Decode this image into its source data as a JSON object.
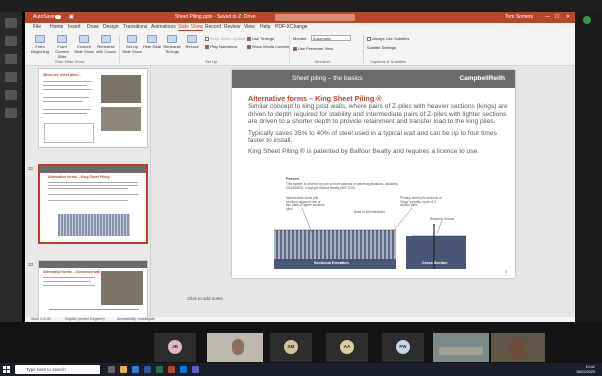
{
  "window": {
    "autosave_label": "AutoSave",
    "title": "Sheet Piling.pptx - Saved to Z: Drive",
    "user": "Tom Somers"
  },
  "ribbon_tabs": [
    "File",
    "Home",
    "Insert",
    "Draw",
    "Design",
    "Transitions",
    "Animations",
    "Slide Show",
    "Record",
    "Review",
    "View",
    "Help",
    "PDF-XChange"
  ],
  "active_tab": "Slide Show",
  "ribbon_tools": {
    "buttons": [
      {
        "label": "From Beginning"
      },
      {
        "label": "From Current Slide"
      },
      {
        "label": "Custom Slide Show"
      },
      {
        "label": "Rehearse with Coach"
      },
      {
        "label": "Set Up Slide Show"
      },
      {
        "label": "Hide Slide"
      },
      {
        "label": "Rehearse Timings"
      },
      {
        "label": "Record"
      }
    ],
    "checks": [
      {
        "label": "Keep Slides Updated"
      },
      {
        "label": "Play Narrations"
      },
      {
        "label": "Use Timings"
      },
      {
        "label": "Show Media Controls"
      },
      {
        "label": "Use Presenter View"
      },
      {
        "label": "Always Use Subtitles"
      },
      {
        "label": "Subtitle Settings"
      }
    ],
    "monitor_label": "Monitor:",
    "monitor_value": "Automatic",
    "groups": [
      "Start Slide Show",
      "Set Up",
      "Monitors",
      "Captions & Subtitles"
    ]
  },
  "thumbnails": [
    {
      "num": "",
      "title": "When are sheet piles..."
    },
    {
      "num": "22",
      "title": "Alternative forms – King Sheet Piling"
    },
    {
      "num": "23",
      "title": "Alternative forms – Combined wall"
    }
  ],
  "slide": {
    "header": "Sheet piling – the basics",
    "logo": "CampbellReith",
    "heading": "Alternative forms – King Sheet Piling ®",
    "para1": "Similar concept to king post walls, where pairs of Z-piles with heavier sections (kings) are driven to depth required for stability and intermediate pairs of Z-piles with lighter sections are driven to a shorter depth to provide retainment and transfer load to the king piles.",
    "para2": "Typically saves 35% to 40% of steel used in a typical wall and can be up to four times faster to install.",
    "para3": "King Sheet Piling ® is patented by Balfour Beatty and requires a licence to use.",
    "figure": {
      "caption_title": "Passes",
      "caption_body": "This system is covered by one or more patents or patent applications, including GB2463876. Copyright Balfour Beatty plc® 2008.",
      "label_intermediate": "Intermediate sheet pile sections adjacent one or two pairs of lighter sections piles",
      "label_primary": "Primary sheet pile sections or 'kings' typically a pair of Z section piles",
      "label_base": "Base of intermediates",
      "label_retained": "Retained Ground",
      "elevation": "Sectional Elevation",
      "section": "Cross Section"
    },
    "page_number": "3"
  },
  "notes_placeholder": "Click to add notes",
  "status": {
    "slide_info": "Slide 3 of 25",
    "language": "English (United Kingdom)",
    "accessibility": "Accessibility: Investigate"
  },
  "participants": [
    "JB",
    "SM",
    "AA",
    "PW"
  ],
  "taskbar": {
    "search_placeholder": "Type here to search",
    "time": "10:42",
    "date": "15/02/2023"
  },
  "colors": {
    "ppt_accent": "#b7472a",
    "slide_header": "#6b6b6b",
    "pile_fill": "#8a94aa"
  }
}
